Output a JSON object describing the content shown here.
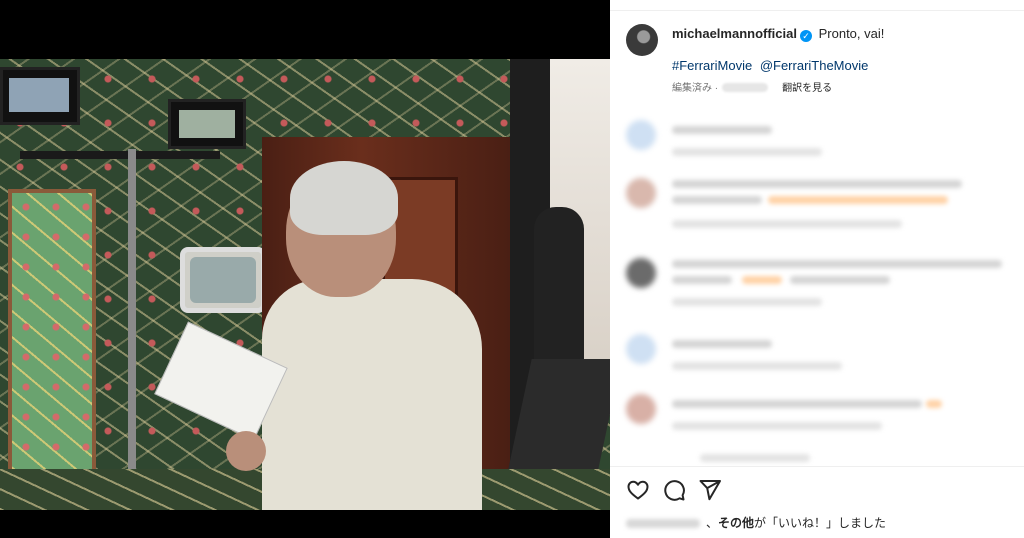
{
  "post": {
    "username": "michaelmannofficial",
    "verified_mark": "✓",
    "caption": "Pronto, vai!",
    "hashtag": "#FerrariMovie",
    "mention": "@FerrariTheMovie",
    "edited_label": "編集済み ·",
    "see_translation": "翻訳を見る"
  },
  "likes": {
    "prefix": "、",
    "others": "その他",
    "suffix": "が「いいね！」しました"
  },
  "icons": {
    "like": "heart-icon",
    "comment": "comment-icon",
    "share": "send-icon"
  },
  "colors": {
    "link": "#00376b",
    "verified": "#0095f6",
    "muted": "#737373"
  }
}
